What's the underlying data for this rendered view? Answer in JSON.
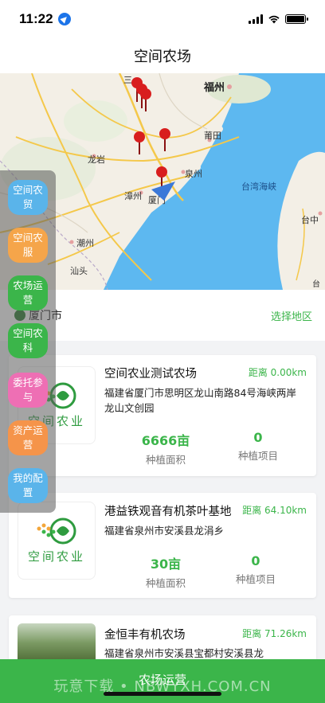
{
  "status_bar": {
    "time": "11:22"
  },
  "nav": {
    "title": "空间农场"
  },
  "map": {
    "labels": {
      "fuzhou": "福州",
      "putian": "莆田",
      "longyan": "龙岩",
      "quanzhou": "泉州",
      "zhangzhou": "漳州",
      "xiamen": "厦门",
      "chaozhou": "潮州",
      "shantou": "汕头",
      "taiwan_strait": "台湾海峡",
      "taichung": "台中",
      "taibei_partial": "台",
      "sanming_partial": "三"
    },
    "colors": {
      "sea": "#5db8f0",
      "land": "#f3efe6",
      "road": "#f4c84a",
      "pin": "#d81e1e",
      "locator": "#3b78d8"
    }
  },
  "region": {
    "city": "厦门市",
    "select_label": "选择地区"
  },
  "side_menu": [
    {
      "label": "空间农贸",
      "color": "#5ab4ea"
    },
    {
      "label": "空间农服",
      "color": "#f5a54a"
    },
    {
      "label": "农场运营",
      "color": "#3bb54a"
    },
    {
      "label": "空间农科",
      "color": "#3bb54a"
    },
    {
      "label": "委托参与",
      "color": "#ee6fb4"
    },
    {
      "label": "资产运营",
      "color": "#f5944a"
    },
    {
      "label": "我的配置",
      "color": "#5ab4ea"
    }
  ],
  "farms": [
    {
      "name": "空间农业测试农场",
      "distance": "距离 0.00km",
      "address": "福建省厦门市思明区龙山南路84号海峡两岸龙山文创园",
      "area_value": "6666亩",
      "area_label": "种植面积",
      "projects_value": "0",
      "projects_label": "种植项目",
      "logo_text": "空间农业"
    },
    {
      "name": "港益铁观音有机茶叶基地",
      "distance": "距离 64.10km",
      "address": "福建省泉州市安溪县龙涓乡",
      "area_value": "30亩",
      "area_label": "种植面积",
      "projects_value": "0",
      "projects_label": "种植项目",
      "logo_text": "空间农业"
    },
    {
      "name": "金恒丰有机农场",
      "distance": "距离 71.26km",
      "address": "福建省泉州市安溪县宝都村安溪县龙"
    }
  ],
  "bottom_bar": {
    "label": "农场运营"
  },
  "watermark": "玩意下载 • NBWYXH.COM.CN"
}
